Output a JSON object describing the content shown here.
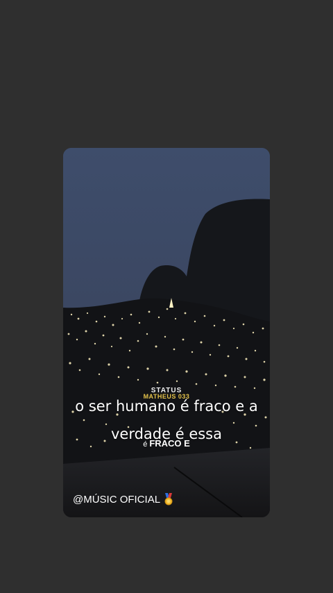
{
  "watermark": {
    "top": "STATUS",
    "bottom": "MATHEUS 033"
  },
  "caption": {
    "line1": "o ser humano é fraco e a",
    "line2": "verdade é essa"
  },
  "subcaption": {
    "small": "é",
    "big": "FRACO E"
  },
  "handle": {
    "text": "@MÚSIC OFICIAL",
    "icon": "medal-icon"
  },
  "colors": {
    "page_background": "#2f2f2f",
    "sky": "#3b4a66",
    "watermark_gold": "#e3c24a",
    "text": "#ffffff"
  }
}
